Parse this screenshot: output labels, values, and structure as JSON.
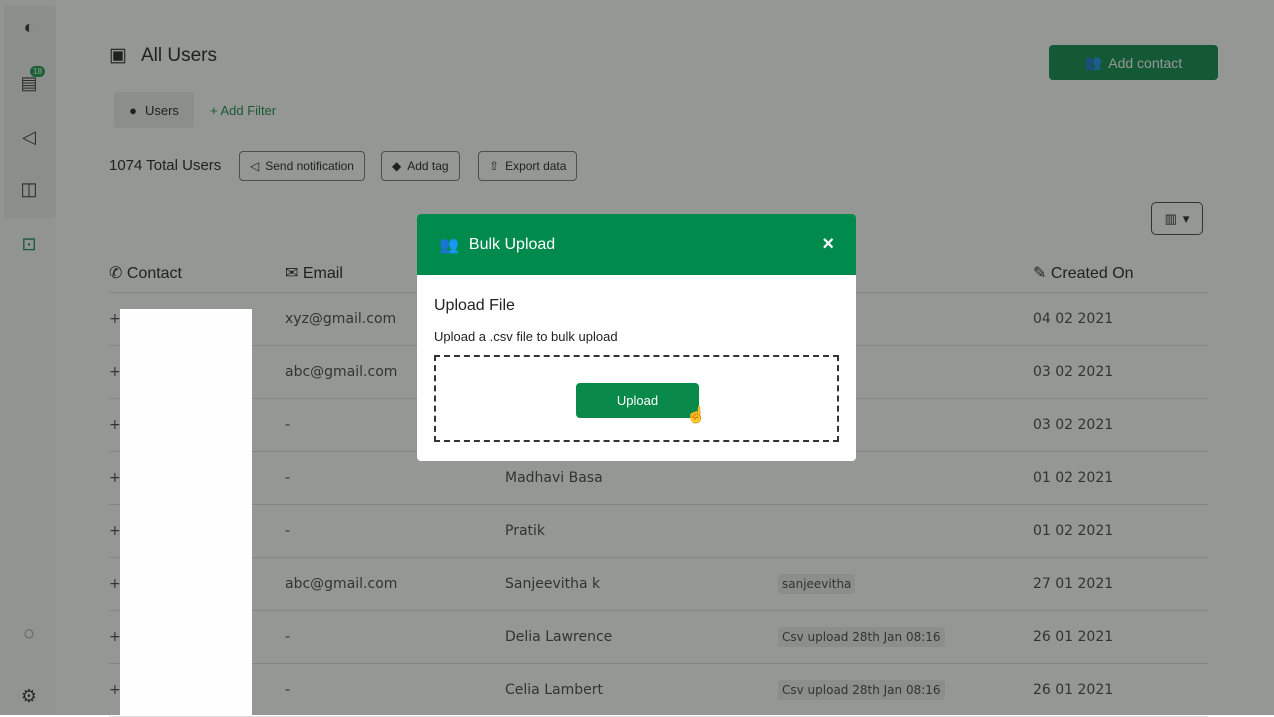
{
  "sidebar": {
    "items": [
      {
        "icon": "chat-bubble-icon"
      },
      {
        "icon": "inbox-icon",
        "badge": "18"
      },
      {
        "icon": "send-icon"
      },
      {
        "icon": "layout-icon"
      },
      {
        "icon": "contacts-icon"
      },
      {
        "icon": "message-icon"
      },
      {
        "icon": "settings-icon"
      }
    ]
  },
  "header": {
    "title": "All Users",
    "add_contact": "Add contact"
  },
  "filters": {
    "chip": "Users",
    "add_filter": "+ Add Filter"
  },
  "toolbar": {
    "total": "1074 Total Users",
    "send_notification": "Send notification",
    "add_tag": "Add tag",
    "export_data": "Export data"
  },
  "table": {
    "headers": {
      "contact": "Contact",
      "email": "Email",
      "created": "Created On"
    },
    "rows": [
      {
        "contact": "+9",
        "email": "xyz@gmail.com",
        "name": "",
        "tag": "",
        "created": "04 02 2021"
      },
      {
        "contact": "+9",
        "email": "abc@gmail.com",
        "name": "",
        "tag": "",
        "created": "03 02 2021"
      },
      {
        "contact": "+9",
        "email": "-",
        "name": "",
        "tag": "",
        "created": "03 02 2021"
      },
      {
        "contact": "+9",
        "email": "-",
        "name": "Madhavi Basa",
        "tag": "",
        "created": "01 02 2021"
      },
      {
        "contact": "+9",
        "email": "-",
        "name": "Pratik",
        "tag": "",
        "created": "01 02 2021"
      },
      {
        "contact": "+9",
        "email": "abc@gmail.com",
        "name": "Sanjeevitha k",
        "tag": "sanjeevitha",
        "created": "27 01 2021"
      },
      {
        "contact": "+9",
        "email": "-",
        "name": "Delia Lawrence",
        "tag": "Csv upload 28th Jan 08:16",
        "created": "26 01 2021"
      },
      {
        "contact": "+4",
        "email": "-",
        "name": "Celia Lambert",
        "tag": "Csv upload 28th Jan 08:16",
        "created": "26 01 2021"
      }
    ]
  },
  "modal": {
    "title": "Bulk Upload",
    "close": "×",
    "heading": "Upload File",
    "subtitle": "Upload a .csv file to bulk upload",
    "upload": "Upload"
  },
  "colors": {
    "brand": "#008a4b"
  }
}
